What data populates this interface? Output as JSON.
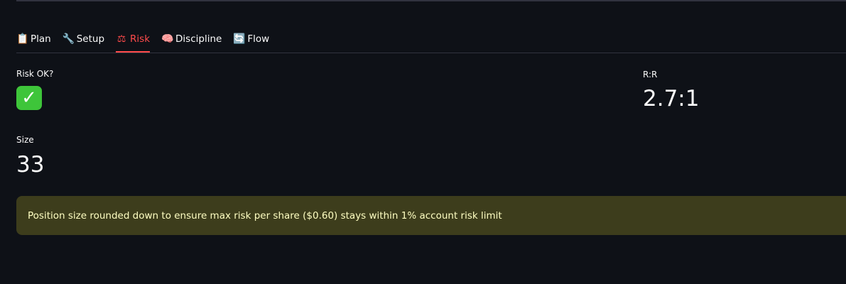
{
  "tabs": [
    {
      "icon": "📋",
      "icon_name": "clipboard-icon",
      "label": "Plan",
      "active": false
    },
    {
      "icon": "🔧",
      "icon_name": "wrench-icon",
      "label": "Setup",
      "active": false
    },
    {
      "icon": "⚖",
      "icon_name": "scales-icon",
      "label": "Risk",
      "active": true
    },
    {
      "icon": "🧠",
      "icon_name": "brain-icon",
      "label": "Discipline",
      "active": false
    },
    {
      "icon": "🔄",
      "icon_name": "cycle-icon",
      "label": "Flow",
      "active": false
    }
  ],
  "metrics": {
    "risk_ok": {
      "label": "Risk OK?",
      "value_icon": "check-mark-icon",
      "value_glyph": "✓"
    },
    "rr": {
      "label": "R:R",
      "value": "2.7:1"
    },
    "size": {
      "label": "Size",
      "value": "33"
    }
  },
  "alert": {
    "message": "Position size rounded down to ensure max risk per share ($0.60) stays within 1% account risk limit"
  },
  "colors": {
    "background": "#0e1117",
    "accent": "#ff4b4b",
    "alert_bg": "#3d3d1c",
    "alert_text": "#ffffc2",
    "check_bg": "#3ec53a"
  }
}
